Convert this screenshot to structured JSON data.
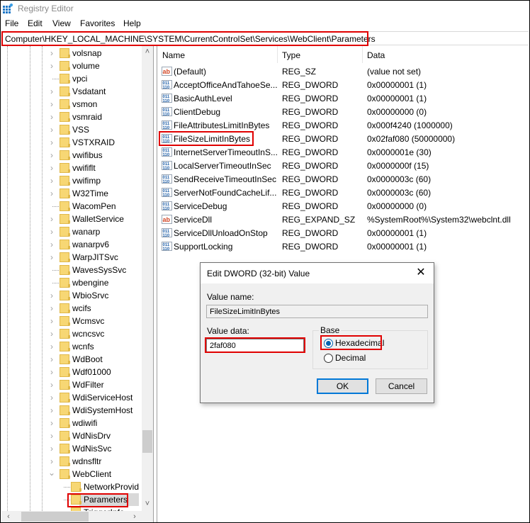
{
  "window": {
    "title": "Registry Editor",
    "menu": [
      "File",
      "Edit",
      "View",
      "Favorites",
      "Help"
    ],
    "address": "Computer\\HKEY_LOCAL_MACHINE\\SYSTEM\\CurrentControlSet\\Services\\WebClient\\Parameters"
  },
  "tree": {
    "items": [
      {
        "label": "volsnap",
        "expander": "collapsed"
      },
      {
        "label": "volume",
        "expander": "collapsed"
      },
      {
        "label": "vpci",
        "expander": "none"
      },
      {
        "label": "Vsdatant",
        "expander": "collapsed"
      },
      {
        "label": "vsmon",
        "expander": "collapsed"
      },
      {
        "label": "vsmraid",
        "expander": "collapsed"
      },
      {
        "label": "VSS",
        "expander": "collapsed"
      },
      {
        "label": "VSTXRAID",
        "expander": "collapsed"
      },
      {
        "label": "vwifibus",
        "expander": "collapsed"
      },
      {
        "label": "vwififlt",
        "expander": "collapsed"
      },
      {
        "label": "vwifimp",
        "expander": "collapsed"
      },
      {
        "label": "W32Time",
        "expander": "collapsed"
      },
      {
        "label": "WacomPen",
        "expander": "none"
      },
      {
        "label": "WalletService",
        "expander": "collapsed"
      },
      {
        "label": "wanarp",
        "expander": "collapsed"
      },
      {
        "label": "wanarpv6",
        "expander": "collapsed"
      },
      {
        "label": "WarpJITSvc",
        "expander": "collapsed"
      },
      {
        "label": "WavesSysSvc",
        "expander": "none"
      },
      {
        "label": "wbengine",
        "expander": "none"
      },
      {
        "label": "WbioSrvc",
        "expander": "collapsed"
      },
      {
        "label": "wcifs",
        "expander": "collapsed"
      },
      {
        "label": "Wcmsvc",
        "expander": "collapsed"
      },
      {
        "label": "wcncsvc",
        "expander": "collapsed"
      },
      {
        "label": "wcnfs",
        "expander": "collapsed"
      },
      {
        "label": "WdBoot",
        "expander": "collapsed"
      },
      {
        "label": "Wdf01000",
        "expander": "collapsed"
      },
      {
        "label": "WdFilter",
        "expander": "collapsed"
      },
      {
        "label": "WdiServiceHost",
        "expander": "collapsed"
      },
      {
        "label": "WdiSystemHost",
        "expander": "collapsed"
      },
      {
        "label": "wdiwifi",
        "expander": "collapsed"
      },
      {
        "label": "WdNisDrv",
        "expander": "collapsed"
      },
      {
        "label": "WdNisSvc",
        "expander": "collapsed"
      },
      {
        "label": "wdnsfltr",
        "expander": "collapsed"
      },
      {
        "label": "WebClient",
        "expander": "expanded"
      },
      {
        "label": "NetworkProvid",
        "expander": "none",
        "child": true
      },
      {
        "label": "Parameters",
        "expander": "none",
        "child": true,
        "selected": true
      },
      {
        "label": "TriggerInfo",
        "expander": "none",
        "child": true,
        "partial": true
      }
    ]
  },
  "list": {
    "columns": [
      "Name",
      "Type",
      "Data"
    ],
    "rows": [
      {
        "icon": "string",
        "name": "(Default)",
        "type": "REG_SZ",
        "data": "(value not set)"
      },
      {
        "icon": "binary",
        "name": "AcceptOfficeAndTahoeSe...",
        "type": "REG_DWORD",
        "data": "0x00000001 (1)"
      },
      {
        "icon": "binary",
        "name": "BasicAuthLevel",
        "type": "REG_DWORD",
        "data": "0x00000001 (1)"
      },
      {
        "icon": "binary",
        "name": "ClientDebug",
        "type": "REG_DWORD",
        "data": "0x00000000 (0)"
      },
      {
        "icon": "binary",
        "name": "FileAttributesLimitInBytes",
        "type": "REG_DWORD",
        "data": "0x000f4240 (1000000)"
      },
      {
        "icon": "binary",
        "name": "FileSizeLimitInBytes",
        "type": "REG_DWORD",
        "data": "0x02faf080 (50000000)",
        "highlighted": true
      },
      {
        "icon": "binary",
        "name": "InternetServerTimeoutInS...",
        "type": "REG_DWORD",
        "data": "0x0000001e (30)"
      },
      {
        "icon": "binary",
        "name": "LocalServerTimeoutInSec",
        "type": "REG_DWORD",
        "data": "0x0000000f (15)"
      },
      {
        "icon": "binary",
        "name": "SendReceiveTimeoutInSec",
        "type": "REG_DWORD",
        "data": "0x0000003c (60)"
      },
      {
        "icon": "binary",
        "name": "ServerNotFoundCacheLif...",
        "type": "REG_DWORD",
        "data": "0x0000003c (60)"
      },
      {
        "icon": "binary",
        "name": "ServiceDebug",
        "type": "REG_DWORD",
        "data": "0x00000000 (0)"
      },
      {
        "icon": "string",
        "name": "ServiceDll",
        "type": "REG_EXPAND_SZ",
        "data": "%SystemRoot%\\System32\\webclnt.dll"
      },
      {
        "icon": "binary",
        "name": "ServiceDllUnloadOnStop",
        "type": "REG_DWORD",
        "data": "0x00000001 (1)"
      },
      {
        "icon": "binary",
        "name": "SupportLocking",
        "type": "REG_DWORD",
        "data": "0x00000001 (1)"
      }
    ]
  },
  "dialog": {
    "title": "Edit DWORD (32-bit) Value",
    "close": "✕",
    "value_name_label": "Value name:",
    "value_name": "FileSizeLimitInBytes",
    "value_data_label": "Value data:",
    "value_data": "2faf080",
    "base_label": "Base",
    "base_options": [
      "Hexadecimal",
      "Decimal"
    ],
    "base_selected": "Hexadecimal",
    "ok": "OK",
    "cancel": "Cancel"
  },
  "icons": {
    "chevron_right": "›",
    "chevron_down": "⌄",
    "scroll_up": "˄",
    "scroll_down": "˅",
    "scroll_left": "‹",
    "scroll_right": "›"
  },
  "colors": {
    "highlight": "#e00000",
    "folder": "#f7d774",
    "accent": "#0078d7"
  }
}
